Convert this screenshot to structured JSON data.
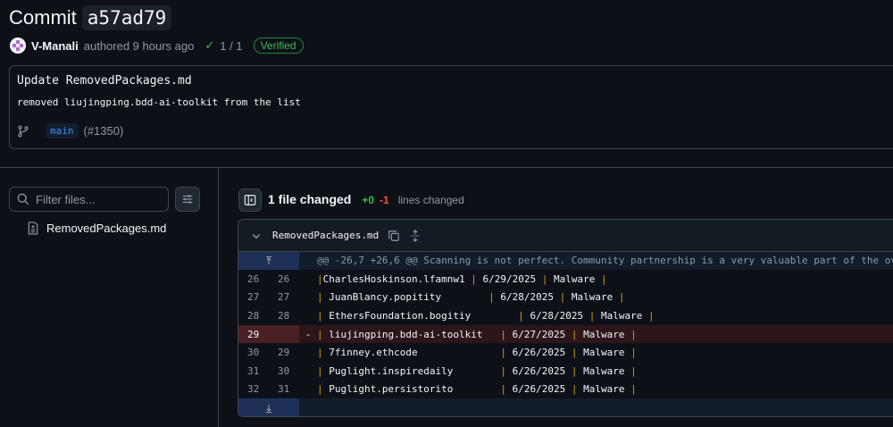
{
  "commit": {
    "title_prefix": "Commit",
    "sha": "a57ad79",
    "author": "V-Manali",
    "authored": "authored 9 hours ago",
    "checks": "1 / 1",
    "verified": "Verified",
    "message_title": "Update RemovedPackages.md",
    "message_body": "removed  liujingping.bdd-ai-toolkit from the list",
    "branch": "main",
    "pr": "(#1350)"
  },
  "sidebar": {
    "filter_placeholder": "Filter files...",
    "files": [
      {
        "name": "RemovedPackages.md"
      }
    ]
  },
  "diff": {
    "files_changed": "1 file changed",
    "additions": "+0",
    "deletions": "-1",
    "lines_changed": "lines changed",
    "file": {
      "name": "RemovedPackages.md",
      "hunk": "@@ -26,7 +26,6 @@ Scanning is not perfect. Community partnership is a very valuable part of the ov",
      "lines": [
        {
          "old": "26",
          "new": "26",
          "marker": "",
          "type": "ctx",
          "pre": "",
          "text": "|CharlesHoskinson.lfamnw1 | 6/29/2025 | Malware |"
        },
        {
          "old": "27",
          "new": "27",
          "marker": "",
          "type": "ctx",
          "pre": "",
          "text": "| JuanBlancy.popitity        | 6/28/2025 | Malware |"
        },
        {
          "old": "28",
          "new": "28",
          "marker": "",
          "type": "ctx",
          "pre": "",
          "text": "| EthersFoundation.bogitiy        | 6/28/2025 | Malware |"
        },
        {
          "old": "29",
          "new": "",
          "marker": "-",
          "type": "del",
          "pre": "",
          "text": "| liujingping.bdd-ai-toolkit   | 6/27/2025 | Malware |"
        },
        {
          "old": "30",
          "new": "29",
          "marker": "",
          "type": "ctx",
          "pre": "",
          "text": "| 7finney.ethcode              | 6/26/2025 | Malware |"
        },
        {
          "old": "31",
          "new": "30",
          "marker": "",
          "type": "ctx",
          "pre": "",
          "text": "| Puglight.inspiredaily        | 6/26/2025 | Malware |"
        },
        {
          "old": "32",
          "new": "31",
          "marker": "",
          "type": "ctx",
          "pre": "",
          "text": "| Puglight.persistorito        | 6/26/2025 | Malware |"
        }
      ]
    }
  },
  "icons": {
    "branch": "git-branch-icon",
    "filter": "search-icon",
    "settings": "sliders-icon",
    "file": "file-diff-icon",
    "copy": "copy-icon",
    "expand": "unfold-icon",
    "collapse": "chevron-down-icon",
    "sidebar_toggle": "sidebar-toggle-icon"
  },
  "colors": {
    "addition": "#3fb950",
    "deletion": "#f85149",
    "accent": "#4493f8",
    "verified": "#3fb950"
  }
}
